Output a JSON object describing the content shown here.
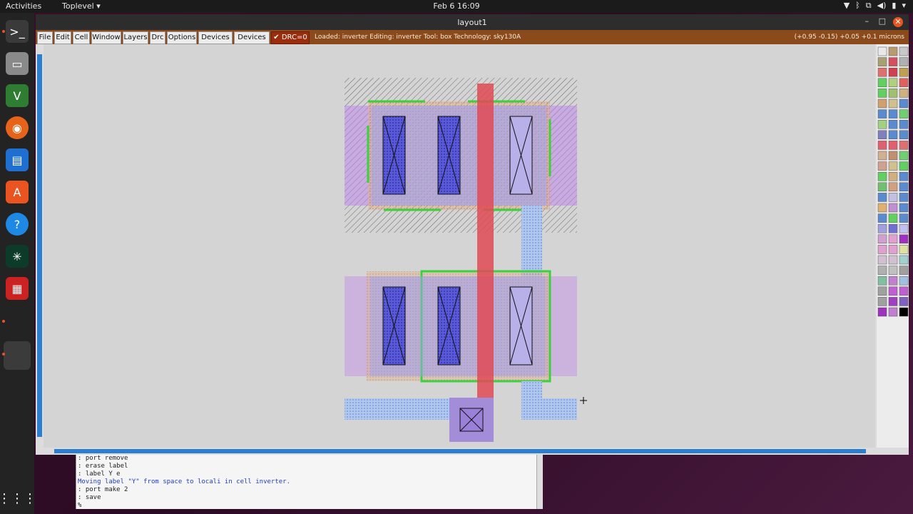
{
  "topbar": {
    "activities": "Activities",
    "app_menu": "Toplevel",
    "clock": "Feb 6  16:09"
  },
  "window": {
    "title": "layout1",
    "minimize": "–",
    "maximize": "□",
    "close": "✕"
  },
  "menu": {
    "file": "File",
    "edit": "Edit",
    "cell": "Cell",
    "window": "Window",
    "layers": "Layers",
    "drc": "Drc",
    "options": "Options",
    "devices1": "Devices 1",
    "devices2": "Devices 2",
    "drc_status": "✔ DRC=0"
  },
  "status_text": "Loaded: inverter  Editing: inverter  Tool: box   Technology: sky130A",
  "coords_text": "(+0.95 -0.15) +0.05 +0.1 microns",
  "console_lines": [
    ": port remove",
    ": erase label",
    ": label Y e",
    "Moving label \"Y\" from space to locali in cell inverter.",
    ": port make 2",
    ": save",
    "%"
  ],
  "colors": {
    "accent_orange": "#8b4a1b",
    "drc_red": "#9b2d0c",
    "scroll_blue": "#2b7fce",
    "poly_red": "#e04a55",
    "diff_green": "#3cd13c",
    "locali_purple": "#b98be0",
    "metal_blue": "#8ab4f0",
    "contact_blue": "#4a4ac8"
  },
  "icons": [
    "terminal-icon",
    "files-icon",
    "vim-icon",
    "firefox-icon",
    "writer-icon",
    "software-icon",
    "help-icon",
    "scope-icon",
    "magic-icon",
    "apps-grid-icon"
  ]
}
